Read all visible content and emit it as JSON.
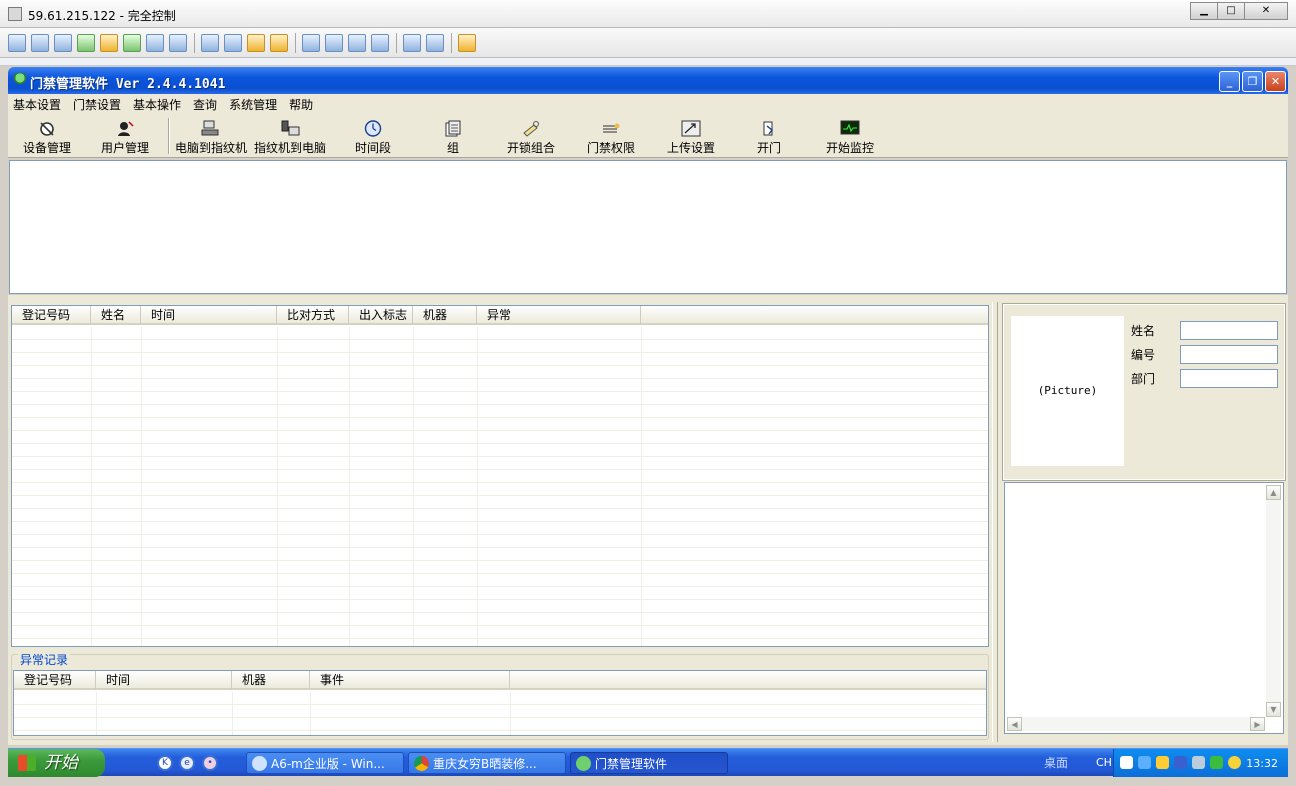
{
  "outer_window": {
    "title": "59.61.215.122 - 完全控制"
  },
  "app": {
    "title": "门禁管理软件  Ver 2.4.4.1041"
  },
  "menu": [
    "基本设置",
    "门禁设置",
    "基本操作",
    "查询",
    "系统管理",
    "帮助"
  ],
  "toolbar": [
    {
      "label": "设备管理",
      "icon": "device-icon"
    },
    {
      "label": "用户管理",
      "icon": "user-icon"
    },
    {
      "label": "电脑到指纹机",
      "icon": "pc-to-fingerprint-icon"
    },
    {
      "label": "指纹机到电脑",
      "icon": "fingerprint-to-pc-icon"
    },
    {
      "label": "时间段",
      "icon": "clock-icon"
    },
    {
      "label": "组",
      "icon": "group-icon"
    },
    {
      "label": "开锁组合",
      "icon": "unlock-combo-icon"
    },
    {
      "label": "门禁权限",
      "icon": "access-permission-icon"
    },
    {
      "label": "上传设置",
      "icon": "upload-icon"
    },
    {
      "label": "开门",
      "icon": "open-door-icon"
    },
    {
      "label": "开始监控",
      "icon": "monitor-icon"
    }
  ],
  "main_grid": {
    "columns": [
      "登记号码",
      "姓名",
      "时间",
      "比对方式",
      "出入标志",
      "机器",
      "异常"
    ]
  },
  "exception_group": {
    "legend": "异常记录",
    "columns": [
      "登记号码",
      "时间",
      "机器",
      "事件"
    ]
  },
  "info_panel": {
    "picture_placeholder": "(Picture)",
    "fields": [
      {
        "label": "姓名",
        "value": ""
      },
      {
        "label": "编号",
        "value": ""
      },
      {
        "label": "部门",
        "value": ""
      }
    ]
  },
  "taskbar": {
    "start_label": "开始",
    "tasks": [
      {
        "label": "A6-m企业版 - Win..."
      },
      {
        "label": "重庆女穷B晒装修..."
      },
      {
        "label": "门禁管理软件"
      }
    ],
    "desktop_label": "桌面",
    "ime": "CH",
    "clock": "13:32"
  },
  "colors": {
    "title_bar": "#0b55dd",
    "window_bg": "#ece9d8",
    "taskbar": "#245edb",
    "start_button": "#3b9a3b",
    "grid_border": "#7f9db9"
  }
}
